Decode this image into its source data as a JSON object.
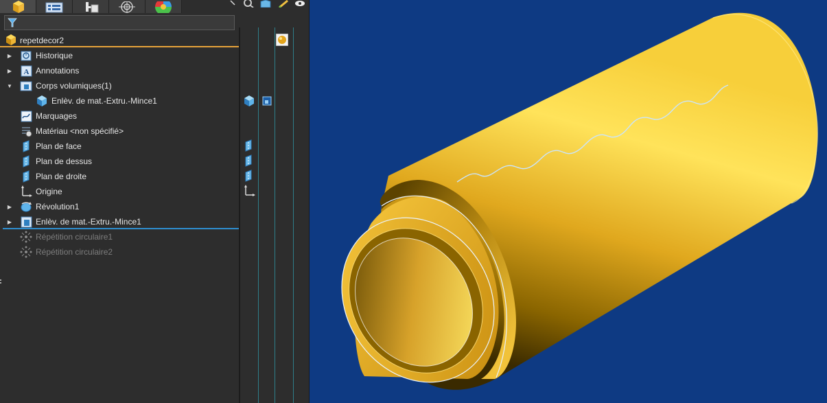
{
  "tabs": [
    {
      "name": "featuremanager-tab",
      "icon": "part-cube-icon",
      "active": true
    },
    {
      "name": "propertymanager-tab",
      "icon": "property-list-icon",
      "active": false
    },
    {
      "name": "configuration-tab",
      "icon": "configuration-icon",
      "active": false
    },
    {
      "name": "dimxpert-tab",
      "icon": "target-icon",
      "active": false
    },
    {
      "name": "display-manager-tab",
      "icon": "color-wheel-icon",
      "active": false
    }
  ],
  "tree": {
    "root": "repetdecor2",
    "items": [
      {
        "label": "Historique",
        "icon": "history-icon",
        "expander": "collapsed",
        "indent": 0
      },
      {
        "label": "Annotations",
        "icon": "annotation-icon",
        "expander": "collapsed",
        "indent": 0
      },
      {
        "label": "Corps volumiques(1)",
        "icon": "solid-bodies-folder-icon",
        "expander": "expanded",
        "indent": 0
      },
      {
        "label": "Enlèv. de mat.-Extru.-Mince1",
        "icon": "solid-body-icon",
        "expander": "none",
        "indent": 1
      },
      {
        "label": "Marquages",
        "icon": "markups-icon",
        "expander": "none",
        "indent": 0
      },
      {
        "label": "Matériau <non spécifié>",
        "icon": "material-icon",
        "expander": "none",
        "indent": 0
      },
      {
        "label": "Plan de face",
        "icon": "plane-icon",
        "expander": "none",
        "indent": 0
      },
      {
        "label": "Plan de dessus",
        "icon": "plane-icon",
        "expander": "none",
        "indent": 0
      },
      {
        "label": "Plan de droite",
        "icon": "plane-icon",
        "expander": "none",
        "indent": 0
      },
      {
        "label": "Origine",
        "icon": "origin-icon",
        "expander": "none",
        "indent": 0
      },
      {
        "label": "Révolution1",
        "icon": "revolve-icon",
        "expander": "collapsed",
        "indent": 0
      },
      {
        "label": "Enlèv. de mat.-Extru.-Mince1",
        "icon": "cut-extrude-icon",
        "expander": "collapsed",
        "indent": 0
      },
      {
        "label": "Répétition circulaire1",
        "icon": "circular-pattern-icon",
        "expander": "none",
        "indent": 0,
        "suppressed": true
      },
      {
        "label": "Répétition circulaire2",
        "icon": "circular-pattern-icon",
        "expander": "none",
        "indent": 0,
        "suppressed": true
      }
    ]
  },
  "colors": {
    "viewport_bg": "#0e3a83",
    "part_yellow": "#f2c63a",
    "rollback_bar": "#2e8fd1",
    "root_underline": "#e8a33a"
  }
}
